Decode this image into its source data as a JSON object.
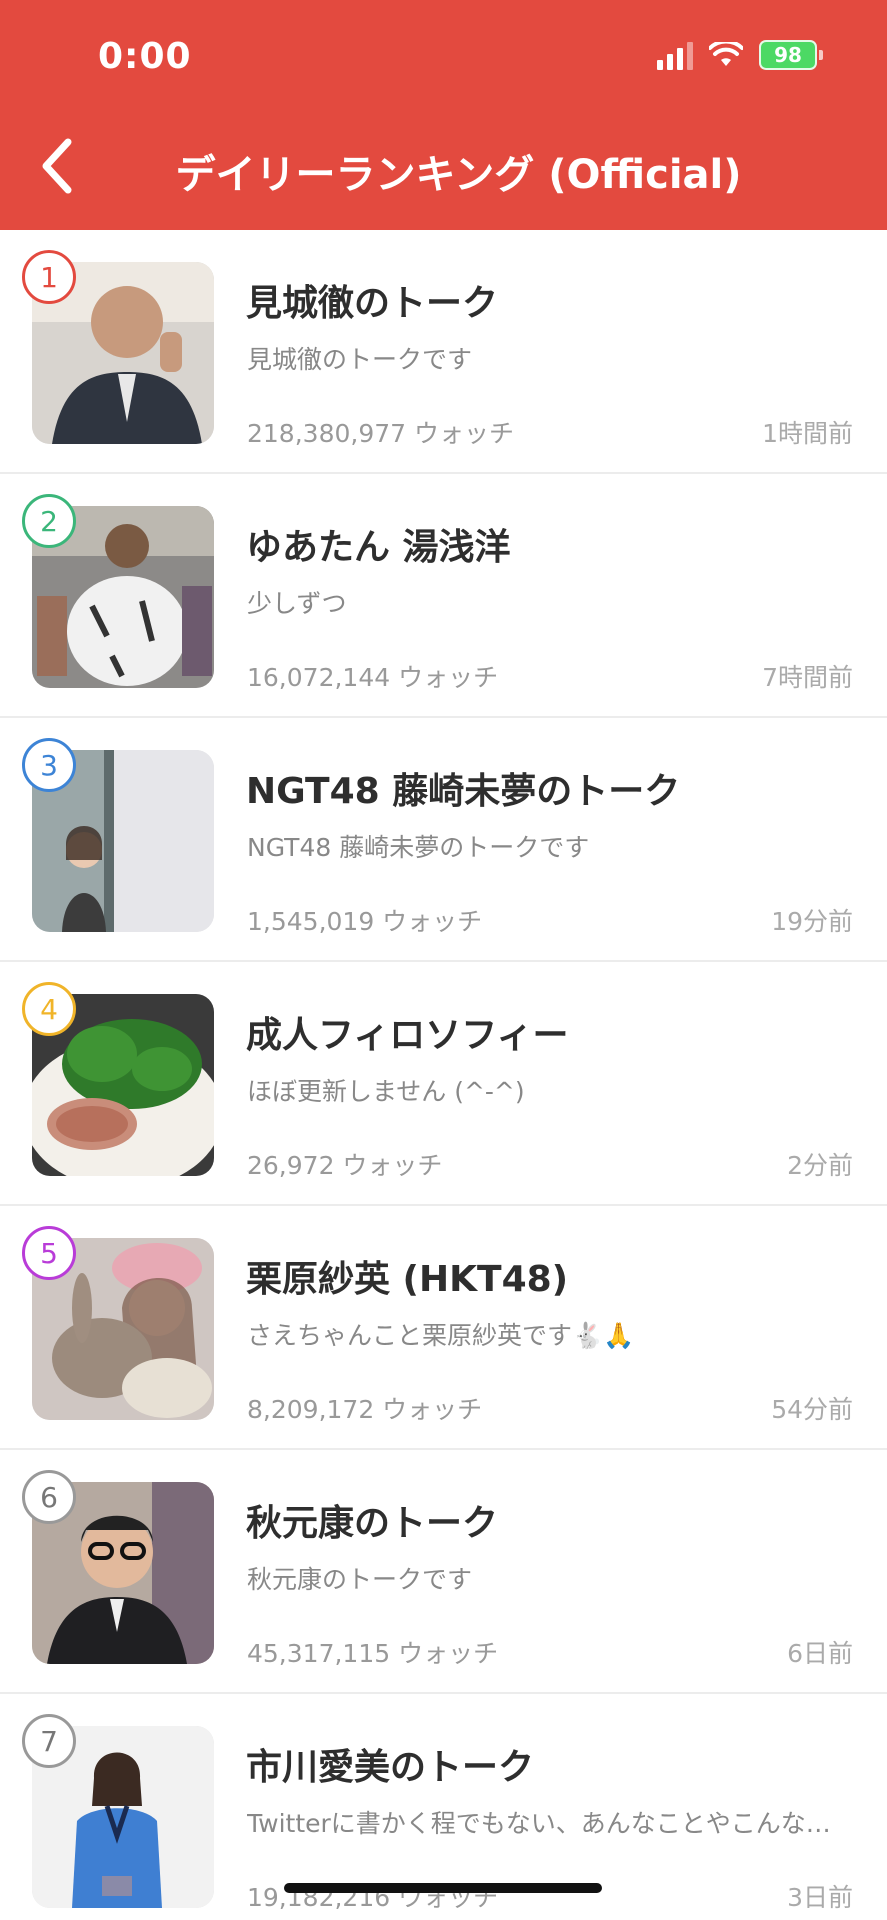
{
  "status_bar": {
    "time": "0:00",
    "battery": "98"
  },
  "header": {
    "title": "デイリーランキング (Official)"
  },
  "ranking": [
    {
      "rank": "1",
      "rank_color": "#e34a3f",
      "name": "見城徹のトーク",
      "desc": "見城徹のトークです",
      "watch": "218,380,977 ウォッチ",
      "time": "1時間前"
    },
    {
      "rank": "2",
      "rank_color": "#3bb67a",
      "name": "ゆあたん 湯浅洋",
      "desc": "少しずつ",
      "watch": "16,072,144 ウォッチ",
      "time": "7時間前"
    },
    {
      "rank": "3",
      "rank_color": "#3d84d6",
      "name": "NGT48 藤崎未夢のトーク",
      "desc": "NGT48 藤崎未夢のトークです",
      "watch": "1,545,019 ウォッチ",
      "time": "19分前"
    },
    {
      "rank": "4",
      "rank_color": "#f0b429",
      "name": "成人フィロソフィー",
      "desc": "ほぼ更新しません (^-^)",
      "watch": "26,972 ウォッチ",
      "time": "2分前"
    },
    {
      "rank": "5",
      "rank_color": "#b93cd8",
      "name": "栗原紗英 (HKT48)",
      "desc": "さえちゃんこと栗原紗英です🐇🙏",
      "watch": "8,209,172 ウォッチ",
      "time": "54分前"
    },
    {
      "rank": "6",
      "rank_color": "#999999",
      "name": "秋元康のトーク",
      "desc": "秋元康のトークです",
      "watch": "45,317,115 ウォッチ",
      "time": "6日前"
    },
    {
      "rank": "7",
      "rank_color": "#999999",
      "name": "市川愛美のトーク",
      "desc": "Twitterに書かく程でもない、あんなことやこんな…",
      "watch": "19,182,216 ウォッチ",
      "time": "3日前"
    }
  ]
}
